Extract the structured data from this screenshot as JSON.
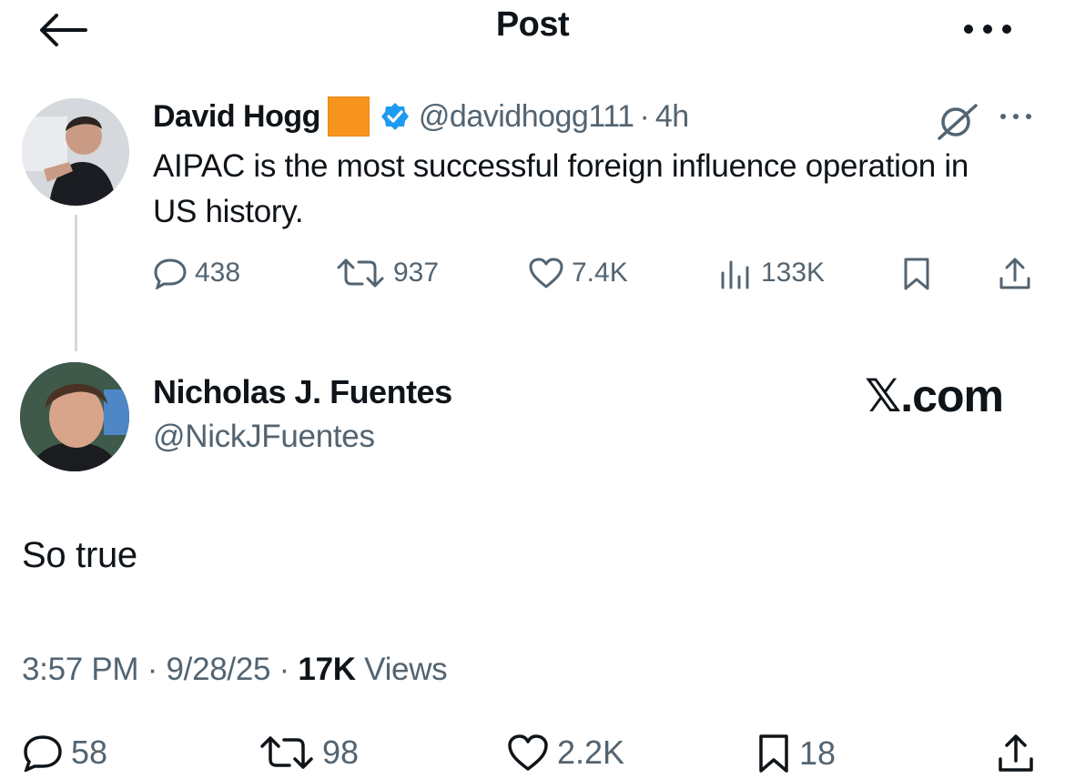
{
  "header": {
    "title": "Post",
    "back_icon": "arrow-left-icon",
    "more_icon": "more-horizontal-icon"
  },
  "quoted_post": {
    "author_name": "David Hogg",
    "author_badge_color": "#f7941e",
    "verified_color": "#1d9bf0",
    "handle": "@davidhogg111",
    "separator": "·",
    "time": "4h",
    "text": "AIPAC is the most successful foreign influence operation in US history.",
    "grok_icon": "grok-icon",
    "more_icon": "more-horizontal-icon",
    "stats": {
      "replies": "438",
      "reposts": "937",
      "likes": "7.4K",
      "views": "133K"
    }
  },
  "post": {
    "author_name": "Nicholas J. Fuentes",
    "handle": "@NickJFuentes",
    "watermark": "𝕏.com",
    "text": "So true",
    "time": "3:57 PM",
    "separator": "·",
    "date": "9/28/25",
    "views_count": "17K",
    "views_label": "Views",
    "stats": {
      "replies": "58",
      "reposts": "98",
      "likes": "2.2K",
      "bookmarks": "18"
    }
  }
}
